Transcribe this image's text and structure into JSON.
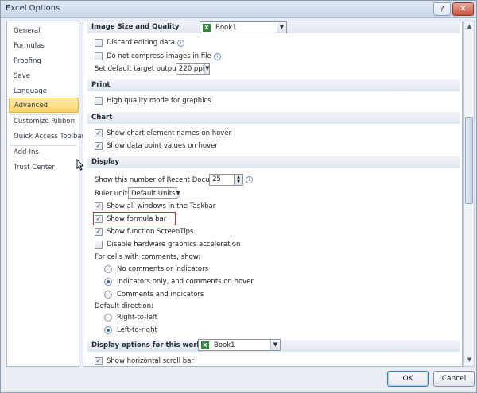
{
  "window": {
    "title": "Excel Options",
    "help_glyph": "?",
    "close_glyph": "✕"
  },
  "nav": {
    "items": [
      {
        "label": "General"
      },
      {
        "label": "Formulas"
      },
      {
        "label": "Proofing"
      },
      {
        "label": "Save"
      },
      {
        "label": "Language"
      },
      {
        "label": "Advanced",
        "active": true
      },
      {
        "label": "Customize Ribbon"
      },
      {
        "label": "Quick Access Toolbar"
      },
      {
        "label": "Add-Ins"
      },
      {
        "label": "Trust Center"
      }
    ]
  },
  "image_section": {
    "title": "Image Size and Quality",
    "workbook": "Book1",
    "discard": "Discard editing data",
    "compress": "Do not compress images in file",
    "target_label": "Set default target output to:",
    "target_value": "220 ppi"
  },
  "print_section": {
    "title": "Print",
    "high_quality": "High quality mode for graphics"
  },
  "chart_section": {
    "title": "Chart",
    "element_names": "Show chart element names on hover",
    "point_values": "Show data point values on hover"
  },
  "display_section": {
    "title": "Display",
    "recent_label": "Show this number of Recent Documents:",
    "recent_value": "25",
    "ruler_label": "Ruler units",
    "ruler_value": "Default Units",
    "all_windows": "Show all windows in the Taskbar",
    "formula_bar": "Show formula bar",
    "screentips": "Show function ScreenTips",
    "hw_accel": "Disable hardware graphics acceleration",
    "comments_label": "For cells with comments, show:",
    "no_comments": "No comments or indicators",
    "indicators_only": "Indicators only, and comments on hover",
    "comments_indicators": "Comments and indicators",
    "direction_label": "Default direction:",
    "rtl": "Right-to-left",
    "ltr": "Left-to-right"
  },
  "workbook_section": {
    "title": "Display options for this workbook:",
    "workbook": "Book1",
    "hscroll": "Show horizontal scroll bar"
  },
  "buttons": {
    "ok": "OK",
    "cancel": "Cancel"
  },
  "colors": {
    "active_nav": "#fbd56a",
    "highlight": "#d12a2a"
  }
}
